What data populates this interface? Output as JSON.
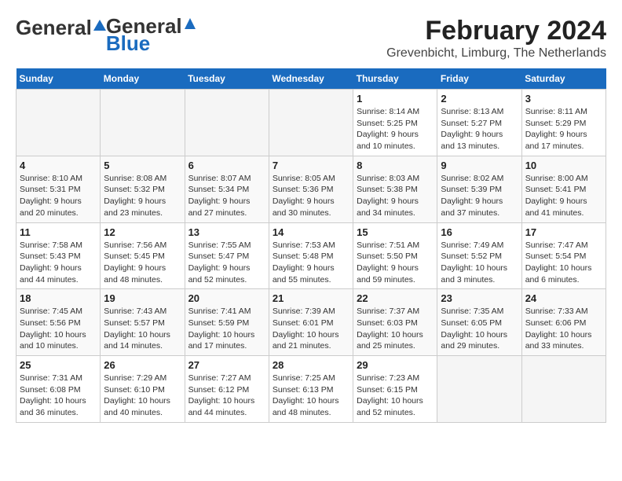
{
  "header": {
    "logo_general": "General",
    "logo_blue": "Blue",
    "title": "February 2024",
    "subtitle": "Grevenbicht, Limburg, The Netherlands"
  },
  "calendar": {
    "days_of_week": [
      "Sunday",
      "Monday",
      "Tuesday",
      "Wednesday",
      "Thursday",
      "Friday",
      "Saturday"
    ],
    "weeks": [
      [
        {
          "day": "",
          "info": ""
        },
        {
          "day": "",
          "info": ""
        },
        {
          "day": "",
          "info": ""
        },
        {
          "day": "",
          "info": ""
        },
        {
          "day": "1",
          "info": "Sunrise: 8:14 AM\nSunset: 5:25 PM\nDaylight: 9 hours\nand 10 minutes."
        },
        {
          "day": "2",
          "info": "Sunrise: 8:13 AM\nSunset: 5:27 PM\nDaylight: 9 hours\nand 13 minutes."
        },
        {
          "day": "3",
          "info": "Sunrise: 8:11 AM\nSunset: 5:29 PM\nDaylight: 9 hours\nand 17 minutes."
        }
      ],
      [
        {
          "day": "4",
          "info": "Sunrise: 8:10 AM\nSunset: 5:31 PM\nDaylight: 9 hours\nand 20 minutes."
        },
        {
          "day": "5",
          "info": "Sunrise: 8:08 AM\nSunset: 5:32 PM\nDaylight: 9 hours\nand 23 minutes."
        },
        {
          "day": "6",
          "info": "Sunrise: 8:07 AM\nSunset: 5:34 PM\nDaylight: 9 hours\nand 27 minutes."
        },
        {
          "day": "7",
          "info": "Sunrise: 8:05 AM\nSunset: 5:36 PM\nDaylight: 9 hours\nand 30 minutes."
        },
        {
          "day": "8",
          "info": "Sunrise: 8:03 AM\nSunset: 5:38 PM\nDaylight: 9 hours\nand 34 minutes."
        },
        {
          "day": "9",
          "info": "Sunrise: 8:02 AM\nSunset: 5:39 PM\nDaylight: 9 hours\nand 37 minutes."
        },
        {
          "day": "10",
          "info": "Sunrise: 8:00 AM\nSunset: 5:41 PM\nDaylight: 9 hours\nand 41 minutes."
        }
      ],
      [
        {
          "day": "11",
          "info": "Sunrise: 7:58 AM\nSunset: 5:43 PM\nDaylight: 9 hours\nand 44 minutes."
        },
        {
          "day": "12",
          "info": "Sunrise: 7:56 AM\nSunset: 5:45 PM\nDaylight: 9 hours\nand 48 minutes."
        },
        {
          "day": "13",
          "info": "Sunrise: 7:55 AM\nSunset: 5:47 PM\nDaylight: 9 hours\nand 52 minutes."
        },
        {
          "day": "14",
          "info": "Sunrise: 7:53 AM\nSunset: 5:48 PM\nDaylight: 9 hours\nand 55 minutes."
        },
        {
          "day": "15",
          "info": "Sunrise: 7:51 AM\nSunset: 5:50 PM\nDaylight: 9 hours\nand 59 minutes."
        },
        {
          "day": "16",
          "info": "Sunrise: 7:49 AM\nSunset: 5:52 PM\nDaylight: 10 hours\nand 3 minutes."
        },
        {
          "day": "17",
          "info": "Sunrise: 7:47 AM\nSunset: 5:54 PM\nDaylight: 10 hours\nand 6 minutes."
        }
      ],
      [
        {
          "day": "18",
          "info": "Sunrise: 7:45 AM\nSunset: 5:56 PM\nDaylight: 10 hours\nand 10 minutes."
        },
        {
          "day": "19",
          "info": "Sunrise: 7:43 AM\nSunset: 5:57 PM\nDaylight: 10 hours\nand 14 minutes."
        },
        {
          "day": "20",
          "info": "Sunrise: 7:41 AM\nSunset: 5:59 PM\nDaylight: 10 hours\nand 17 minutes."
        },
        {
          "day": "21",
          "info": "Sunrise: 7:39 AM\nSunset: 6:01 PM\nDaylight: 10 hours\nand 21 minutes."
        },
        {
          "day": "22",
          "info": "Sunrise: 7:37 AM\nSunset: 6:03 PM\nDaylight: 10 hours\nand 25 minutes."
        },
        {
          "day": "23",
          "info": "Sunrise: 7:35 AM\nSunset: 6:05 PM\nDaylight: 10 hours\nand 29 minutes."
        },
        {
          "day": "24",
          "info": "Sunrise: 7:33 AM\nSunset: 6:06 PM\nDaylight: 10 hours\nand 33 minutes."
        }
      ],
      [
        {
          "day": "25",
          "info": "Sunrise: 7:31 AM\nSunset: 6:08 PM\nDaylight: 10 hours\nand 36 minutes."
        },
        {
          "day": "26",
          "info": "Sunrise: 7:29 AM\nSunset: 6:10 PM\nDaylight: 10 hours\nand 40 minutes."
        },
        {
          "day": "27",
          "info": "Sunrise: 7:27 AM\nSunset: 6:12 PM\nDaylight: 10 hours\nand 44 minutes."
        },
        {
          "day": "28",
          "info": "Sunrise: 7:25 AM\nSunset: 6:13 PM\nDaylight: 10 hours\nand 48 minutes."
        },
        {
          "day": "29",
          "info": "Sunrise: 7:23 AM\nSunset: 6:15 PM\nDaylight: 10 hours\nand 52 minutes."
        },
        {
          "day": "",
          "info": ""
        },
        {
          "day": "",
          "info": ""
        }
      ]
    ]
  }
}
